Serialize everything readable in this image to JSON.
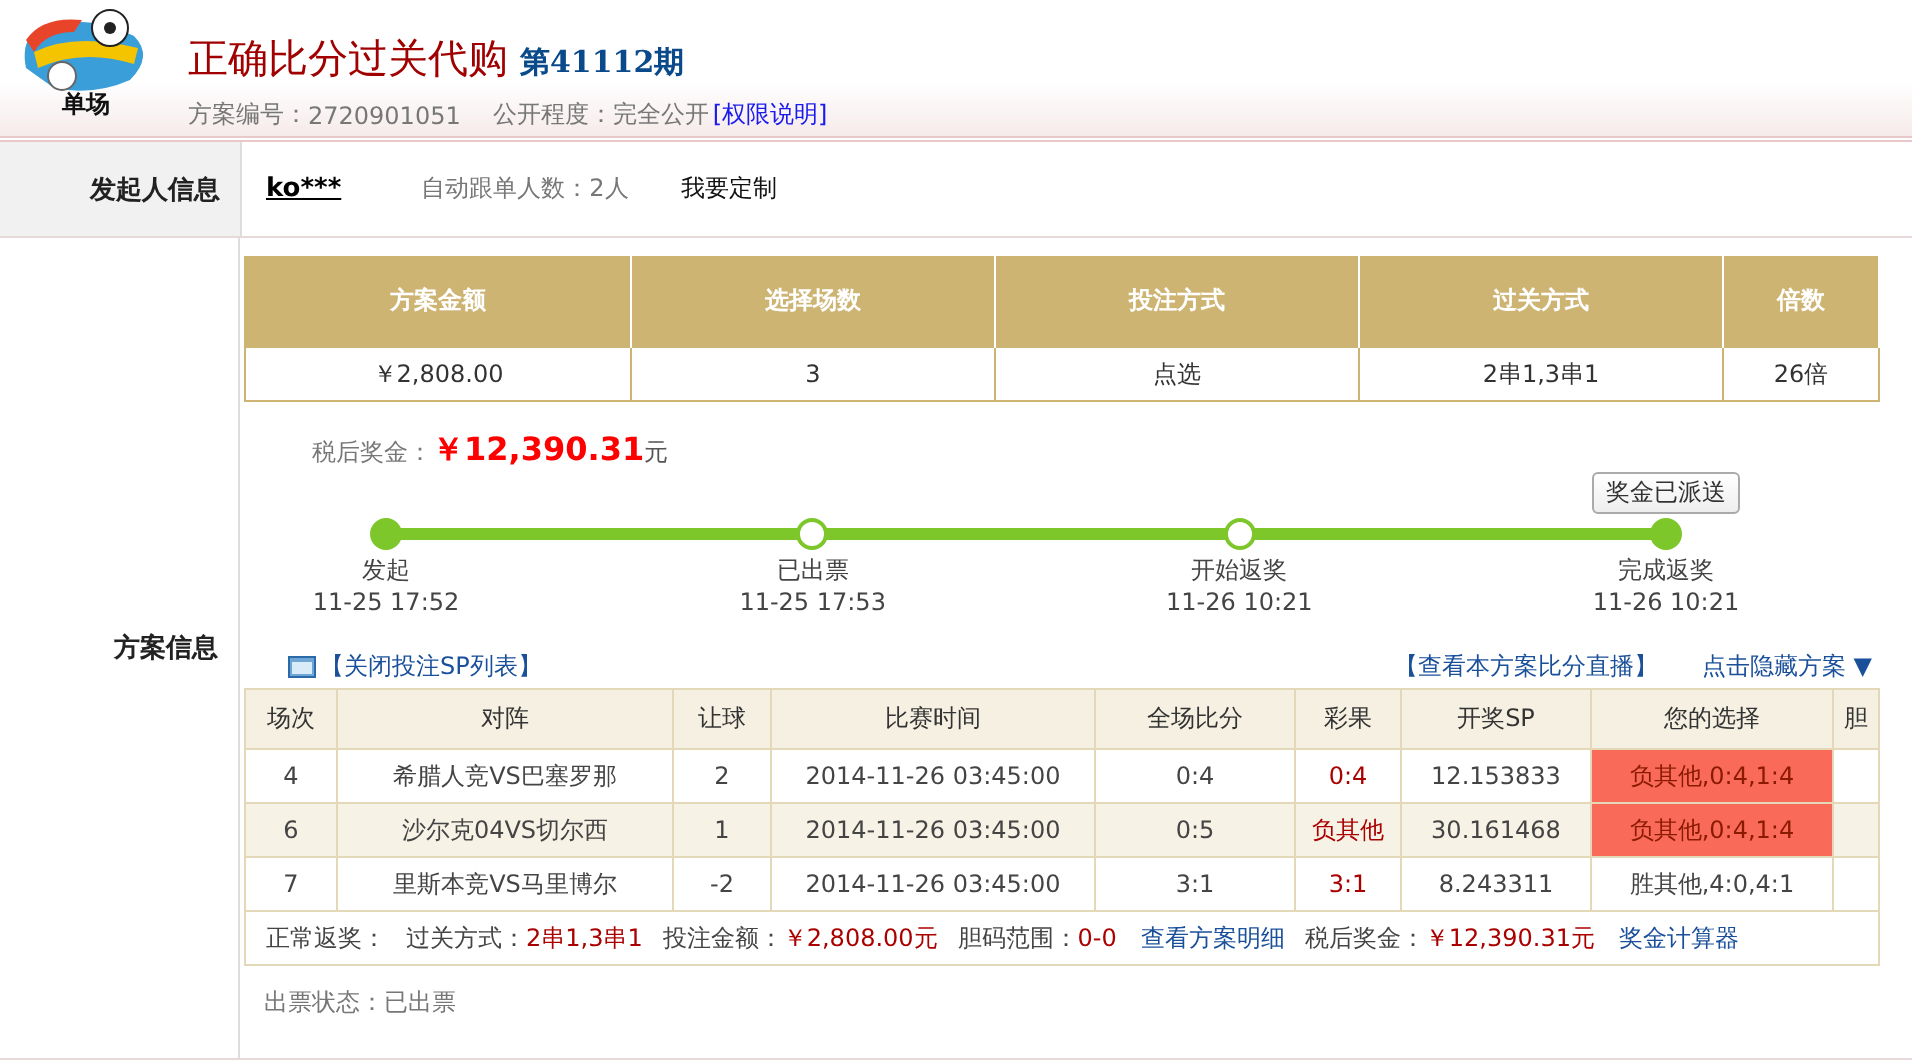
{
  "header": {
    "logo_caption": "单场",
    "title": "正确比分过关代购",
    "issue": "第41112期",
    "plan_no_label": "方案编号：",
    "plan_no": "2720901051",
    "visibility_label": "公开程度：",
    "visibility": "完全公开",
    "permission_link": "[权限说明]"
  },
  "initiator": {
    "label": "发起人信息",
    "user": "ko***",
    "followers_label": "自动跟单人数：",
    "followers": "2人",
    "customize": "我要定制"
  },
  "plan": {
    "label": "方案信息",
    "summary": {
      "columns": [
        "方案金额",
        "选择场数",
        "投注方式",
        "过关方式",
        "倍数"
      ],
      "values": [
        "￥2,808.00",
        "3",
        "点选",
        "2串1,3串1",
        "26倍"
      ]
    },
    "prize_label": "税后奖金：",
    "prize": "￥12,390.31",
    "prize_unit": "元",
    "prize_badge": "奖金已派送",
    "timeline": [
      {
        "label": "发起",
        "time": "11-25 17:52",
        "filled": true
      },
      {
        "label": "已出票",
        "time": "11-25 17:53",
        "filled": false
      },
      {
        "label": "开始返奖",
        "time": "11-26 10:21",
        "filled": false
      },
      {
        "label": "完成返奖",
        "time": "11-26 10:21",
        "filled": true
      }
    ],
    "sp_toggle": "【关闭投注SP列表】",
    "live_link": "【查看本方案比分直播】",
    "hide_link": "点击隐藏方案 ▼",
    "table": {
      "columns": [
        "场次",
        "对阵",
        "让球",
        "比赛时间",
        "全场比分",
        "彩果",
        "开奖SP",
        "您的选择",
        "胆"
      ],
      "rows": [
        {
          "no": "4",
          "match": "希腊人竞VS巴塞罗那",
          "handicap": "2",
          "time": "2014-11-26 03:45:00",
          "score": "0:4",
          "result": "0:4",
          "sp": "12.153833",
          "choice": "负其他,0:4,1:4",
          "hit": true,
          "highlighted": false
        },
        {
          "no": "6",
          "match": "沙尔克04VS切尔西",
          "handicap": "1",
          "time": "2014-11-26 03:45:00",
          "score": "0:5",
          "result": "负其他",
          "sp": "30.161468",
          "choice": "负其他,0:4,1:4",
          "hit": true,
          "highlighted": true
        },
        {
          "no": "7",
          "match": "里斯本竞VS马里博尔",
          "handicap": "-2",
          "time": "2014-11-26 03:45:00",
          "score": "3:1",
          "result": "3:1",
          "sp": "8.243311",
          "choice": "胜其他,4:0,4:1",
          "hit": false,
          "highlighted": false
        }
      ]
    },
    "footer": [
      {
        "kind": "label",
        "text": "正常返奖："
      },
      {
        "kind": "label",
        "text": "过关方式："
      },
      {
        "kind": "value",
        "text": "2串1,3串1"
      },
      {
        "kind": "label",
        "text": "投注金额："
      },
      {
        "kind": "value",
        "text": "￥2,808.00元"
      },
      {
        "kind": "label",
        "text": "胆码范围："
      },
      {
        "kind": "value",
        "text": "0-0"
      },
      {
        "kind": "link",
        "text": "查看方案明细"
      },
      {
        "kind": "label",
        "text": "税后奖金："
      },
      {
        "kind": "value",
        "text": "￥12,390.31元"
      },
      {
        "kind": "link",
        "text": "奖金计算器"
      }
    ],
    "ticket_status_label": "出票状态：",
    "ticket_status": "已出票"
  }
}
